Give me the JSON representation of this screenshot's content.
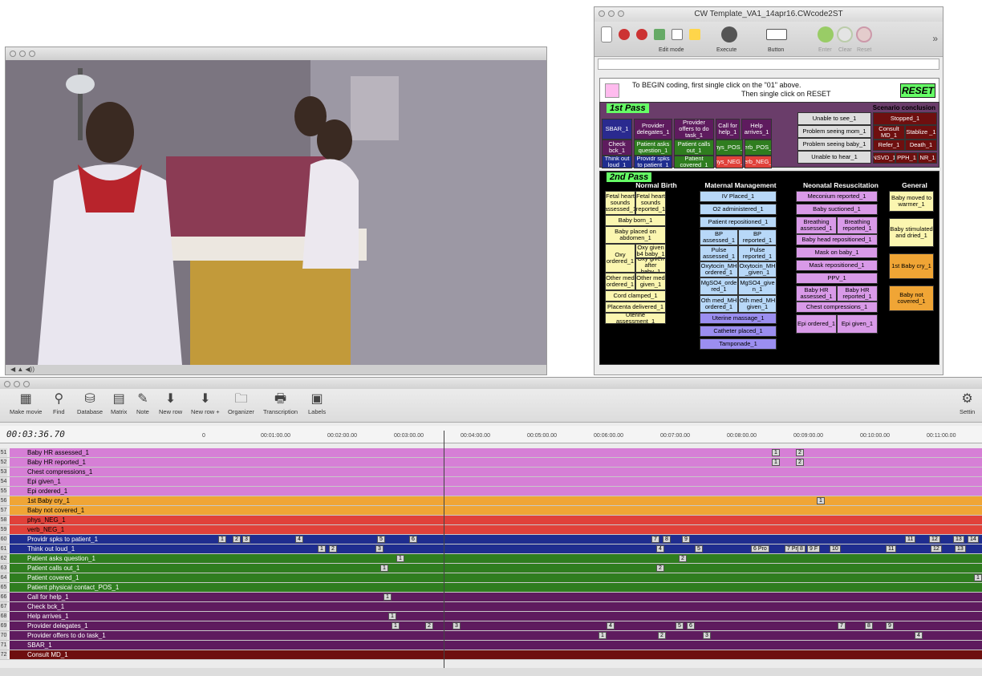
{
  "video": {
    "controls": "◀ ▲    ◀))"
  },
  "coder": {
    "title": "CW Template_VA1_14apr16.CWcode2ST",
    "toolbar": {
      "edit_mode": "Edit mode",
      "execute": "Execute",
      "button": "Button",
      "enter": "Enter",
      "clear": "Clear",
      "reset": "Reset",
      "more": "»"
    },
    "instr_line1": "To BEGIN coding, first single click on the \"01\" above.",
    "instr_line2": "Then single click on RESET",
    "reset": "RESET",
    "pass1": {
      "label": "1st Pass",
      "scenario": "Scenario conclusion",
      "buttons": [
        "SBAR_1",
        "Provider delegates_1",
        "Provider offers to do task_1",
        "Call for help_1",
        "Help arrives_1",
        "Check bck_1",
        "Patient asks question_1",
        "Patient calls out_1",
        "phys_POS_1",
        "verb_POS_1",
        "Think out loud_1",
        "Providr spks to patient_1",
        "Patient covered_1",
        "phys_NEG_1",
        "verb_NEG_1",
        "Unable to see_1",
        "Problem seeing mom_1",
        "Problem seeing baby_1",
        "Unable to hear_1",
        "Stopped_1",
        "Consult MD_1",
        "Stablize _1",
        "Refer_1",
        "Death_1",
        "NSVD_1",
        "PPH_1",
        "NR_1"
      ]
    },
    "pass2": {
      "label": "2nd Pass",
      "headers": [
        "Normal Birth",
        "Maternal Management",
        "Neonatal Resuscitation",
        "General"
      ],
      "normal": [
        "Fetal heart sounds assessed_1",
        "Fetal heart sounds reported_1",
        "Baby born_1",
        "Baby placed on abdomen_1",
        "Oxy ordered_1",
        "Oxy given b4 baby_1",
        "Oxy given after baby_1",
        "Other med ordered_1",
        "Other med given_1",
        "Cord clamped_1",
        "Placenta delivered_1",
        "Uterine assessment_1"
      ],
      "maternal": [
        "IV Placed_1",
        "O2 administered_1",
        "Patient repositioned_1",
        "BP assessed_1",
        "BP reported_1",
        "Pulse assessed_1",
        "Pulse reported_1",
        "Oxytocin_MH ordered_1",
        "Oxytocin_MH _given_1",
        "MgSO4_orde red_1",
        "MgSO4_give n_1",
        "Oth med_MH ordered_1",
        "Oth med_MH given_1",
        "Uterine massage_1",
        "Catheter placed_1",
        "Tamponade_1"
      ],
      "neonatal": [
        "Meconium reported_1",
        "Baby suctioned_1",
        "Breathing assessed_1",
        "Breathing reported_1",
        "Baby head repositioned_1",
        "Mask on baby_1",
        "Mask repositioned_1",
        "PPV_1",
        "Baby HR assessed_1",
        "Baby HR reported_1",
        "Chest compressions_1",
        "Epi ordered_1",
        "Epi given_1"
      ],
      "general": [
        "Baby moved to warmer_1",
        "Baby stimulated and dried_1",
        "1st Baby cry_1",
        "Baby not covered_1"
      ]
    }
  },
  "timeline": {
    "toolbar": [
      "Make movie",
      "Find",
      "Database",
      "Matrix",
      "Note",
      "New row",
      "New row +",
      "Organizer",
      "Transcription",
      "Labels"
    ],
    "settings": "Settin",
    "timecode": "00:03:36.70",
    "ticks": [
      "0",
      "00:01:00.00",
      "00:02:00.00",
      "00:03:00.00",
      "00:04:00.00",
      "00:05:00.00",
      "00:06:00.00",
      "00:07:00.00",
      "00:08:00.00",
      "00:09:00.00",
      "00:10:00.00",
      "00:11:00.00"
    ],
    "rows": [
      {
        "n": "51",
        "name": "Baby HR assessed_1",
        "color": "#d67fd6",
        "ev": [
          [
            1,
            "1"
          ],
          [
            2,
            "2"
          ]
        ]
      },
      {
        "n": "52",
        "name": "Baby HR reported_1",
        "color": "#d67fd6",
        "ev": [
          [
            1,
            "1"
          ],
          [
            2,
            "2"
          ]
        ]
      },
      {
        "n": "53",
        "name": "Chest compressions_1",
        "color": "#d67fd6",
        "ev": []
      },
      {
        "n": "54",
        "name": "Epi given_1",
        "color": "#d67fd6",
        "ev": []
      },
      {
        "n": "55",
        "name": "Epi ordered_1",
        "color": "#d67fd6",
        "ev": []
      },
      {
        "n": "56",
        "name": "1st Baby cry_1",
        "color": "#f0a535",
        "ev": [
          [
            3,
            "1"
          ]
        ]
      },
      {
        "n": "57",
        "name": "Baby not covered_1",
        "color": "#f0a535",
        "ev": []
      },
      {
        "n": "58",
        "name": "phys_NEG_1",
        "color": "#e0413a",
        "ev": []
      },
      {
        "n": "59",
        "name": "verb_NEG_1",
        "color": "#e0413a",
        "ev": []
      },
      {
        "n": "60",
        "name": "Providr spks to patient_1",
        "color": "#1f2d8f",
        "ev": [
          [
            4,
            "1"
          ],
          [
            5,
            "2"
          ],
          [
            6,
            "3"
          ],
          [
            7,
            "4"
          ],
          [
            8,
            "5"
          ],
          [
            9,
            "6"
          ],
          [
            10,
            "7"
          ],
          [
            11,
            "8"
          ],
          [
            12,
            "9"
          ],
          [
            13,
            "11"
          ],
          [
            14,
            "12"
          ],
          [
            15,
            "13"
          ],
          [
            16,
            "14"
          ]
        ]
      },
      {
        "n": "61",
        "name": "Think out loud_1",
        "color": "#1f2d8f",
        "ev": [
          [
            17,
            "1"
          ],
          [
            18,
            "2"
          ],
          [
            19,
            "3"
          ],
          [
            20,
            "4"
          ],
          [
            21,
            "5"
          ],
          [
            22,
            "6 Pro"
          ],
          [
            23,
            "7 Pro"
          ],
          [
            24,
            "8"
          ],
          [
            25,
            "9 F"
          ],
          [
            26,
            "10"
          ],
          [
            27,
            "11"
          ],
          [
            28,
            "12"
          ],
          [
            29,
            "13"
          ]
        ]
      },
      {
        "n": "62",
        "name": "Patient asks question_1",
        "color": "#2f7d1f",
        "ev": [
          [
            30,
            "1"
          ],
          [
            31,
            "2"
          ]
        ]
      },
      {
        "n": "63",
        "name": "Patient calls out_1",
        "color": "#2f7d1f",
        "ev": [
          [
            32,
            "1"
          ],
          [
            33,
            "2"
          ]
        ]
      },
      {
        "n": "64",
        "name": "Patient covered_1",
        "color": "#2f7d1f",
        "ev": [
          [
            34,
            "1"
          ]
        ]
      },
      {
        "n": "65",
        "name": "Patient physical contact_POS_1",
        "color": "#2f7d1f",
        "ev": []
      },
      {
        "n": "66",
        "name": "Call for help_1",
        "color": "#5e1b5e",
        "ev": [
          [
            35,
            "1"
          ]
        ]
      },
      {
        "n": "67",
        "name": "Check bck_1",
        "color": "#5e1b5e",
        "ev": []
      },
      {
        "n": "68",
        "name": "Help arrives_1",
        "color": "#5e1b5e",
        "ev": [
          [
            36,
            "1"
          ]
        ]
      },
      {
        "n": "69",
        "name": "Provider delegates_1",
        "color": "#5e1b5e",
        "ev": [
          [
            37,
            "1"
          ],
          [
            38,
            "2"
          ],
          [
            39,
            "3"
          ],
          [
            40,
            "4"
          ],
          [
            41,
            "5"
          ],
          [
            42,
            "6"
          ],
          [
            43,
            "7"
          ],
          [
            44,
            "8"
          ],
          [
            45,
            "9"
          ]
        ]
      },
      {
        "n": "70",
        "name": "Provider offers to do task_1",
        "color": "#5e1b5e",
        "ev": [
          [
            46,
            "1"
          ],
          [
            47,
            "2"
          ],
          [
            48,
            "3"
          ],
          [
            49,
            "4"
          ]
        ]
      },
      {
        "n": "71",
        "name": "SBAR_1",
        "color": "#5e1b5e",
        "ev": []
      },
      {
        "n": "72",
        "name": "Consult MD_1",
        "color": "#6e0f0f",
        "ev": []
      }
    ]
  }
}
